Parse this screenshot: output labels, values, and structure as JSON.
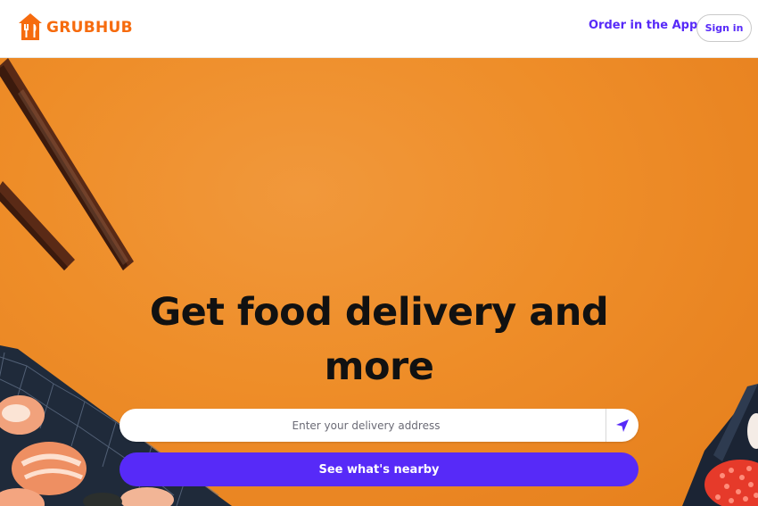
{
  "brand": {
    "name": "GRUBHUB",
    "color": "#f66b0e"
  },
  "header": {
    "order_app_label": "Order in the App",
    "signin_label": "Sign in",
    "accent": "#572af8"
  },
  "hero": {
    "title_line1": "Get food delivery and",
    "title_line2": "more",
    "address_placeholder": "Enter your delivery address",
    "submit_label": "See what's nearby",
    "button_color": "#572af8"
  },
  "icons": {
    "logo": "grubhub-house-utensils-icon",
    "locate": "navigation-arrow-icon"
  }
}
